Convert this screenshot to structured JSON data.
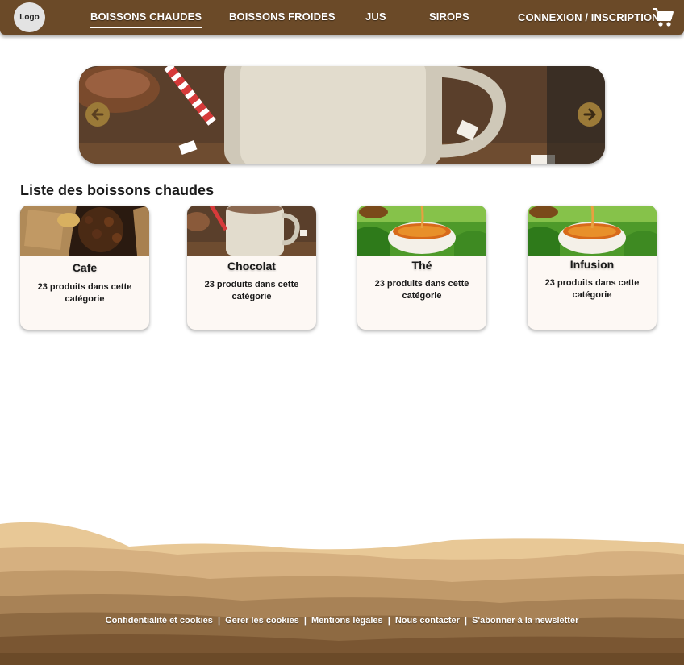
{
  "header": {
    "logo": "Logo",
    "nav": [
      {
        "label": "BOISSONS CHAUDES",
        "active": true
      },
      {
        "label": "BOISSONS FROIDES",
        "active": false
      },
      {
        "label": "JUS",
        "active": false
      },
      {
        "label": "SIROPS",
        "active": false
      }
    ],
    "login": "CONNEXION / INSCRIPTION",
    "cart_icon": "shopping-cart-icon"
  },
  "carousel": {
    "prev_icon": "arrow-left-circle-icon",
    "next_icon": "arrow-right-circle-icon"
  },
  "main": {
    "section_title": "Liste des boissons chaudes",
    "categories": [
      {
        "title": "Cafe",
        "subtitle": "23 produits dans cette catégorie"
      },
      {
        "title": "Chocolat",
        "subtitle": "23 produits dans cette catégorie"
      },
      {
        "title": "Thé",
        "subtitle": "23 produits dans cette catégorie"
      },
      {
        "title": "Infusion",
        "subtitle": "23 produits dans cette catégorie"
      }
    ]
  },
  "footer": {
    "links": [
      "Confidentialité et cookies",
      "Gerer les cookies",
      "Mentions légales",
      "Nous contacter",
      "S'abonner à la newsletter"
    ],
    "separator": "|"
  },
  "colors": {
    "nav_bg": "#6b4a28",
    "card_bg": "#fdf8f4",
    "arrow": "#9b7a38"
  }
}
